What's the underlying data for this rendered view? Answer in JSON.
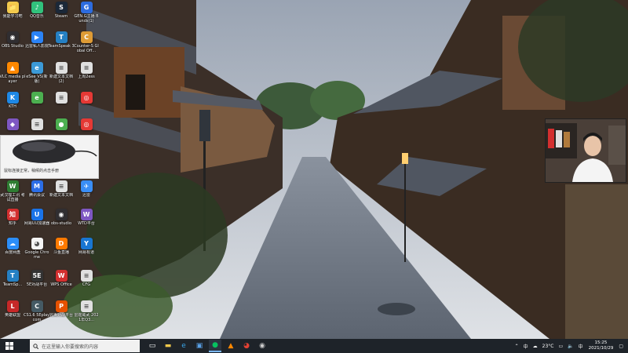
{
  "desktop_icons": [
    {
      "label": "我能学习吧",
      "color": "#f2c94c",
      "glyph": "📁"
    },
    {
      "label": "QQ音乐",
      "color": "#31c27c",
      "glyph": "♪"
    },
    {
      "label": "Steam",
      "color": "#1b2838",
      "glyph": "S"
    },
    {
      "label": "GEN.G主播 Bunds(1)",
      "color": "#2d6cdf",
      "glyph": "G"
    },
    {
      "label": "OBS Studio",
      "color": "#302e31",
      "glyph": "◉"
    },
    {
      "label": "迅雷私人影院",
      "color": "#2b83f6",
      "glyph": "▶"
    },
    {
      "label": "TeamSpeak 3",
      "color": "#2580c3",
      "glyph": "T"
    },
    {
      "label": "Counter-S Global Off...",
      "color": "#de9b35",
      "glyph": "C"
    },
    {
      "label": "VLC media player",
      "color": "#ff8800",
      "glyph": "▲"
    },
    {
      "label": "eSee VS(新版)",
      "color": "#3c9ad7",
      "glyph": "e"
    },
    {
      "label": "新建文本文档(2)",
      "color": "#e0e0e0",
      "glyph": "≡"
    },
    {
      "label": "上周2ess",
      "color": "#e0e0e0",
      "glyph": "≡"
    },
    {
      "label": "KTH",
      "color": "#1e88e5",
      "glyph": "K"
    },
    {
      "label": "",
      "color": "#4caf50",
      "glyph": "e"
    },
    {
      "label": "",
      "color": "#e0e0e0",
      "glyph": "≡"
    },
    {
      "label": "",
      "color": "#e53935",
      "glyph": "◎"
    },
    {
      "label": "",
      "color": "#7e57c2",
      "glyph": "◆"
    },
    {
      "label": "",
      "color": "#e0e0e0",
      "glyph": "≡"
    },
    {
      "label": "",
      "color": "#4caf50",
      "glyph": "●"
    },
    {
      "label": "",
      "color": "#e53935",
      "glyph": "◎"
    },
    {
      "label": "武汉理工讯 考试直播",
      "color": "#2e7d32",
      "glyph": "W"
    },
    {
      "label": "腾讯会议",
      "color": "#2b6de5",
      "glyph": "M"
    },
    {
      "label": "新建文本文档",
      "color": "#e0e0e0",
      "glyph": "≡"
    },
    {
      "label": "迅雷",
      "color": "#3a8ef6",
      "glyph": "✈"
    },
    {
      "label": "知乎",
      "color": "#d32f2f",
      "glyph": "知"
    },
    {
      "label": "网易UU加速器",
      "color": "#1a73e8",
      "glyph": "U"
    },
    {
      "label": "obs-studio",
      "color": "#302e31",
      "glyph": "◉"
    },
    {
      "label": "WTD平台",
      "color": "#7e57c2",
      "glyph": "W"
    },
    {
      "label": "百度网盘",
      "color": "#2c8ef8",
      "glyph": "☁"
    },
    {
      "label": "Google Chrome",
      "color": "#f5f5f5",
      "glyph": "◕"
    },
    {
      "label": "斗鱼直播",
      "color": "#ff7a00",
      "glyph": "D"
    },
    {
      "label": "网易有道",
      "color": "#1976d2",
      "glyph": "Y"
    },
    {
      "label": "TeamSp...",
      "color": "#2580c3",
      "glyph": "T"
    },
    {
      "label": "5E对战平台",
      "color": "#333333",
      "glyph": "5E"
    },
    {
      "label": "WPS Office",
      "color": "#d32f2f",
      "glyph": "W"
    },
    {
      "label": "CFG",
      "color": "#e0e0e0",
      "glyph": "≡"
    },
    {
      "label": "英雄联盟",
      "color": "#c62828",
      "glyph": "L"
    },
    {
      "label": "CS1.6 5Eplay.com",
      "color": "#455a64",
      "glyph": "C"
    },
    {
      "label": "完美对战平台",
      "color": "#e65100",
      "glyph": "P"
    },
    {
      "label": "雷霆威武 2021年Q3...",
      "color": "#e0e0e0",
      "glyph": "≡"
    }
  ],
  "mouse_popup": {
    "caption": "鼠标连接正常，稍候的点击手册"
  },
  "taskbar": {
    "search_placeholder": "在这里输入你要搜索的内容",
    "apps": [
      {
        "name": "task-view",
        "color": "#ffffff",
        "glyph": "▭"
      },
      {
        "name": "file-explorer",
        "color": "#f2c94c",
        "glyph": "▬"
      },
      {
        "name": "edge",
        "color": "#3ba4e6",
        "glyph": "e"
      },
      {
        "name": "store",
        "color": "#5aa0e6",
        "glyph": "▣"
      },
      {
        "name": "wechat",
        "color": "#07c160",
        "glyph": "●",
        "active": true
      },
      {
        "name": "vlc",
        "color": "#ff8800",
        "glyph": "▲"
      },
      {
        "name": "chrome",
        "color": "#e34133",
        "glyph": "◕"
      },
      {
        "name": "obs",
        "color": "#cccccc",
        "glyph": "◉"
      }
    ]
  },
  "tray": {
    "language": "中",
    "weather": "23°C",
    "ime": "中",
    "time": "15:25",
    "date": "2021/10/29"
  }
}
